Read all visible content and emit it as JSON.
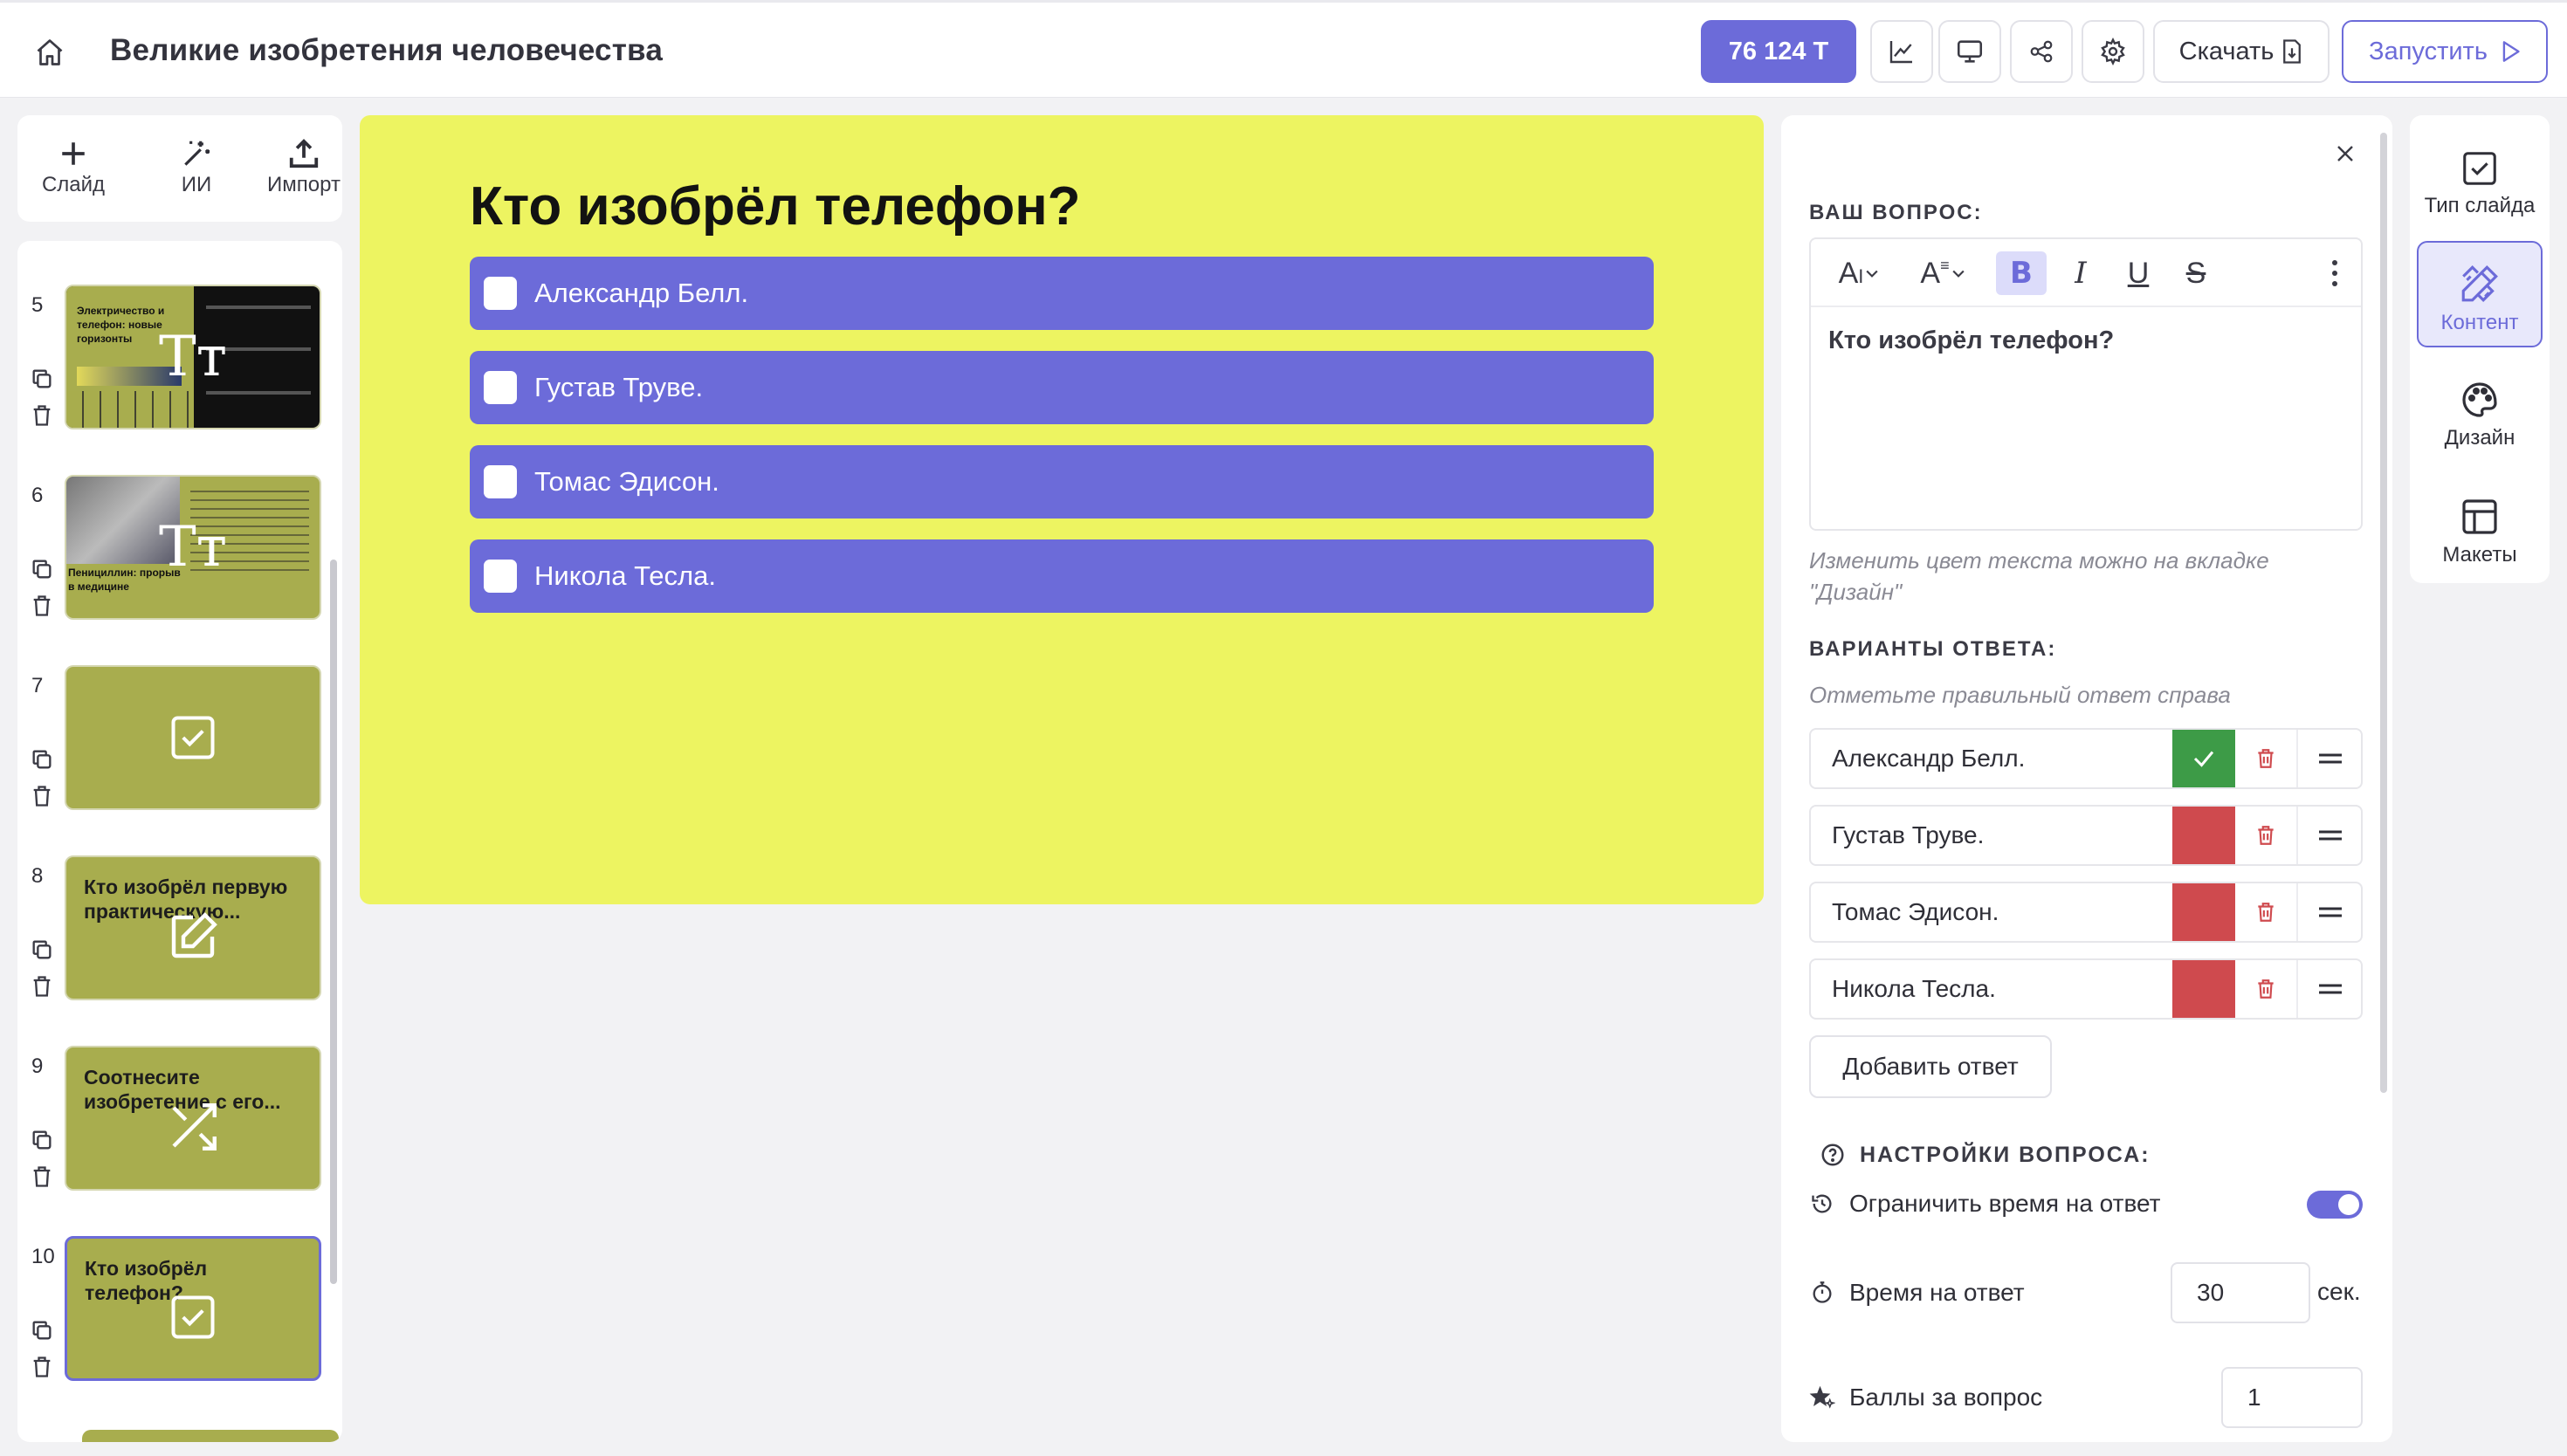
{
  "header": {
    "title": "Великие изобретения человечества",
    "tokens": "76 124 Т",
    "download_label": "Скачать",
    "run_label": "Запустить"
  },
  "left_tools": {
    "slide_label": "Слайд",
    "ai_label": "ИИ",
    "import_label": "Импорт"
  },
  "slides": [
    {
      "number": "5",
      "title": "",
      "type": "text"
    },
    {
      "number": "6",
      "title": "",
      "type": "text"
    },
    {
      "number": "7",
      "title": "",
      "type": "quiz"
    },
    {
      "number": "8",
      "title": "Кто изобрёл первую практическую...",
      "type": "open"
    },
    {
      "number": "9",
      "title": "Соотнесите изобретение с его...",
      "type": "match"
    },
    {
      "number": "10",
      "title": "Кто изобрёл телефон?",
      "type": "quiz",
      "selected": true
    }
  ],
  "slide_previews": {
    "s5_title": "Электричество и телефон: новые горизонты",
    "s6_title": "Пенициллин: прорыв в медицине"
  },
  "canvas": {
    "question": "Кто изобрёл телефон?",
    "answers": [
      "Александр Белл.",
      "Густав Труве.",
      "Томас Эдисон.",
      "Никола Тесла."
    ],
    "background": "#edf461",
    "answer_color": "#6c6bd9"
  },
  "panel": {
    "question_section": "ВАШ ВОПРОС:",
    "question_text": "Кто изобрёл телефон?",
    "color_hint": "Изменить цвет текста можно на вкладке \"Дизайн\"",
    "answers_section": "ВАРИАНТЫ ОТВЕТА:",
    "answers_hint": "Отметьте правильный ответ справа",
    "answers": [
      {
        "label": "Александр Белл.",
        "correct": true
      },
      {
        "label": "Густав Труве.",
        "correct": false
      },
      {
        "label": "Томас Эдисон.",
        "correct": false
      },
      {
        "label": "Никола Тесла.",
        "correct": false
      }
    ],
    "add_answer": "Добавить ответ",
    "settings_section": "НАСТРОЙКИ ВОПРОСА:",
    "limit_time_label": "Ограничить время на ответ",
    "limit_time_on": true,
    "time_label": "Время на ответ",
    "time_value": "30",
    "time_unit": "сек.",
    "points_label": "Баллы за вопрос",
    "points_value": "1"
  },
  "rail": {
    "slide_type": "Тип слайда",
    "content": "Контент",
    "design": "Дизайн",
    "layouts": "Макеты"
  }
}
